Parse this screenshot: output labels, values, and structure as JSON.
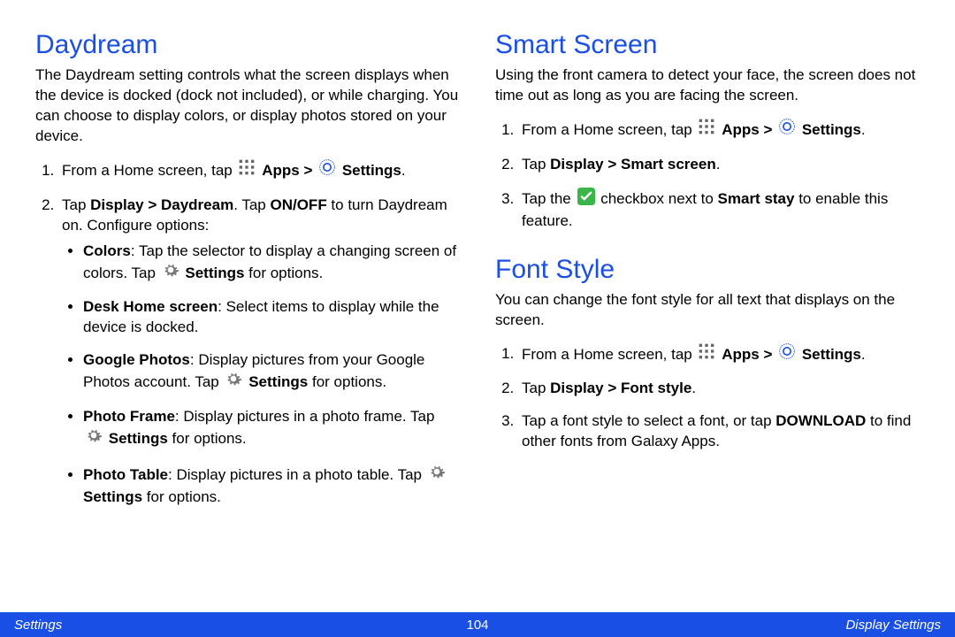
{
  "left": {
    "title": "Daydream",
    "intro": "The Daydream setting controls what the screen displays when the device is docked (dock not included), or while charging. You can choose to display colors, or display photos stored on your device.",
    "step1_a": "From a Home screen, tap ",
    "apps_label": "Apps",
    "gt": " > ",
    "settings_label": "Settings",
    "period": ".",
    "step2_a": "Tap ",
    "step2_path": "Display > Daydream",
    "step2_b": ". Tap ",
    "step2_onoff": "ON/OFF",
    "step2_c": " to turn Daydream on. Configure options:",
    "bullets": {
      "colors_t": "Colors",
      "colors_a": ": Tap the selector to display a changing screen of colors. Tap ",
      "colors_s": "Settings",
      "colors_b": " for options.",
      "desk_t": "Desk Home screen",
      "desk_a": ": Select items to display while the device is docked.",
      "gphoto_t": "Google Photos",
      "gphoto_a": ": Display pictures from your Google Photos account. Tap ",
      "gphoto_s": "Settings",
      "gphoto_b": " for options.",
      "pframe_t": "Photo Frame",
      "pframe_a": ": Display pictures in a photo frame. Tap ",
      "pframe_s": "Settings",
      "pframe_b": " for options.",
      "ptable_t": "Photo Table",
      "ptable_a": ": Display pictures in a photo table. Tap ",
      "ptable_s": "Settings",
      "ptable_b": " for options."
    }
  },
  "right": {
    "smart_title": "Smart Screen",
    "smart_intro": "Using the front camera to detect your face, the screen does not time out as long as you are facing the screen.",
    "s_step1_a": "From a Home screen, tap ",
    "s_apps": "Apps",
    "s_gt": " > ",
    "s_settings": "Settings",
    "s_period": ".",
    "s_step2_a": "Tap ",
    "s_step2_path": "Display > Smart screen",
    "s_step2_b": ".",
    "s_step3_a": "Tap the ",
    "s_step3_b": " checkbox next to ",
    "s_stay": "Smart stay",
    "s_step3_c": " to enable this feature.",
    "font_title": "Font Style",
    "font_intro": "You can change the font style for all text that displays on the screen.",
    "f_step1_a": "From a Home screen, tap ",
    "f_apps": "Apps",
    "f_gt": " > ",
    "f_settings": "Settings",
    "f_period": ".",
    "f_step2_a": "Tap ",
    "f_step2_path": "Display > Font style",
    "f_step2_b": ".",
    "f_step3_a": "Tap a font style to select a font, or tap ",
    "f_download": "DOWNLOAD",
    "f_step3_b": " to find other fonts from Galaxy Apps."
  },
  "footer": {
    "left": "Settings",
    "page": "104",
    "right": "Display Settings"
  }
}
